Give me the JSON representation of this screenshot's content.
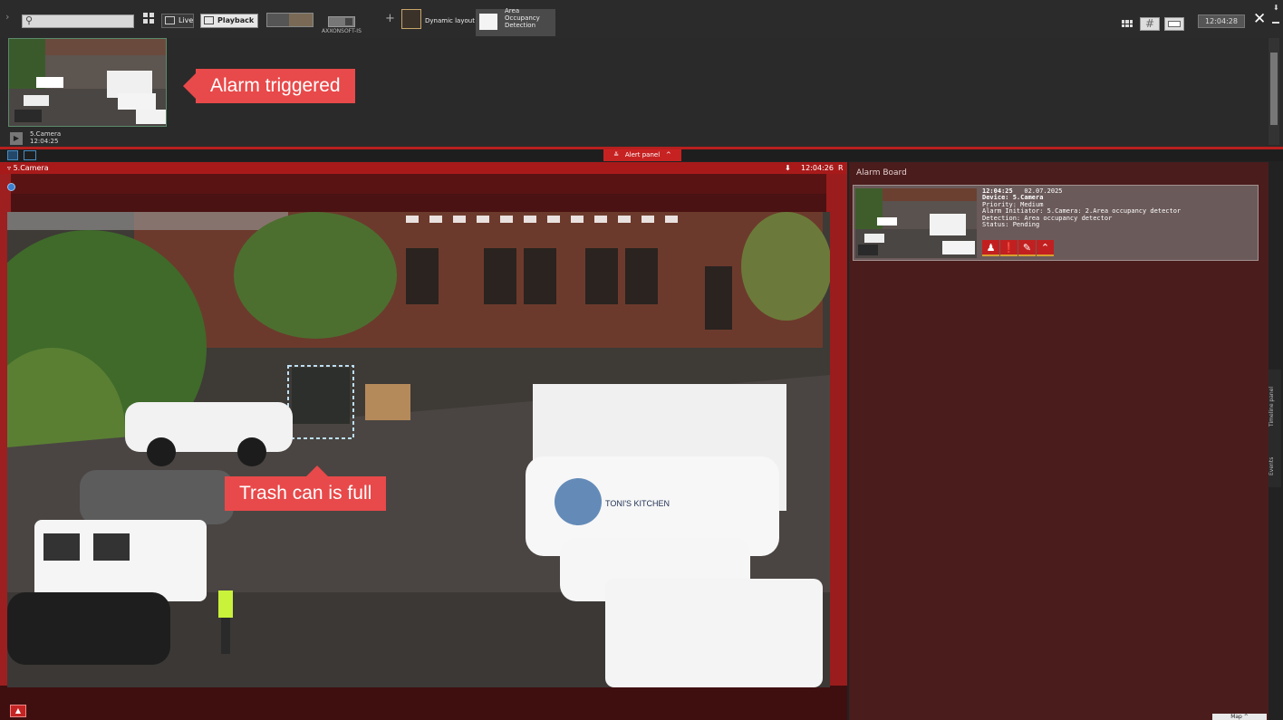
{
  "toolbar": {
    "search_placeholder": "",
    "live_label": "Live",
    "playback_label": "Playback",
    "layout2_label": "AXXONSOFT-IS",
    "dynamic_layout_label": "Dynamic layout",
    "area_tab_label": "Area Occupancy Detection",
    "clock": "12:04:28",
    "icons": [
      "search-icon",
      "grid-icon",
      "plus-icon",
      "tools-icon",
      "pin-icon",
      "minimize-icon"
    ]
  },
  "alarm_strip": {
    "camera_name": "5.Camera",
    "camera_time": "12:04:25",
    "callout": "Alarm triggered"
  },
  "alert_bar": {
    "tab_label": "Alert panel"
  },
  "camera_panel": {
    "title": "5.Camera",
    "time": "12:04:26",
    "indicator": "R",
    "callout": "Trash can is full"
  },
  "alarm_board": {
    "title": "Alarm Board",
    "alarm": {
      "time": "12:04:25",
      "date": "02.07.2025",
      "device": "Device: 5.Camera",
      "priority": "Priority: Medium",
      "initiator": "Alarm Initiator: 5.Camera: 2.Area occupancy detector",
      "detection": "Detection: Area occupancy detector",
      "status": "Status: Pending"
    },
    "action_icons": [
      "bell-icon",
      "warning-icon",
      "pen-icon",
      "escalate-icon"
    ]
  },
  "side_tabs": [
    "Timeline panel",
    "Events"
  ],
  "map_label": "Map",
  "colors": {
    "alarm_red": "#e8494a",
    "panel_red": "#a81a1a",
    "board_bg": "#4a1c1c"
  }
}
